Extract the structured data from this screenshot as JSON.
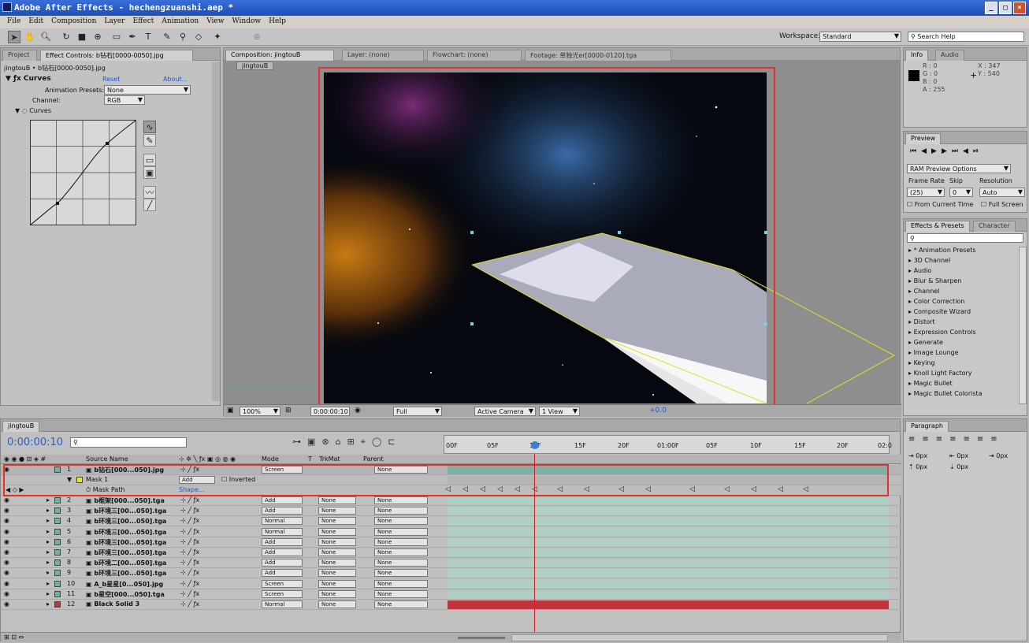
{
  "window": {
    "title": "Adobe After Effects - hechengzuanshi.aep *",
    "buttons": [
      "_",
      "□",
      "×"
    ]
  },
  "menu": [
    "File",
    "Edit",
    "Composition",
    "Layer",
    "Effect",
    "Animation",
    "View",
    "Window",
    "Help"
  ],
  "toolbar": {
    "workspace_label": "Workspace:",
    "workspace_value": "Standard",
    "search_placeholder": "Search Help"
  },
  "project_panel": {
    "tabs": [
      "Project",
      "Effect Controls: b钻石[0000-0050].jpg"
    ],
    "breadcrumb": "jingtouB • b钻石[0000-0050].jpg",
    "effect_name": "Curves",
    "reset": "Reset",
    "about": "About...",
    "presets_label": "Animation Presets:",
    "presets_value": "None",
    "channel_label": "Channel:",
    "channel_value": "RGB",
    "curves_label": "Curves"
  },
  "comp_panel": {
    "tabs": [
      "Composition: jingtouB",
      "Layer: (none)",
      "Flowchart: (none)",
      "Footage: 单独光er[0000-0120].tga"
    ],
    "crumb": "jingtouB",
    "zoom": "100%",
    "time": "0:00:00:10",
    "resolution": "Full",
    "camera": "Active Camera",
    "views": "1 View",
    "exposure": "+0.0"
  },
  "info_panel": {
    "tabs": [
      "Info",
      "Audio"
    ],
    "r": "R : 0",
    "g": "G : 0",
    "b": "B : 0",
    "a": "A : 255",
    "x": "X : 347",
    "y": "Y : 540"
  },
  "preview_panel": {
    "tab": "Preview",
    "ram": "RAM Preview Options",
    "frame_rate_label": "Frame Rate",
    "skip_label": "Skip",
    "resolution_label": "Resolution",
    "frame_rate": "(25)",
    "skip": "0",
    "resolution": "Auto",
    "from_current": "From Current Time",
    "full_screen": "Full Screen"
  },
  "effects_panel": {
    "tabs": [
      "Effects & Presets",
      "Character"
    ],
    "items": [
      "* Animation Presets",
      "3D Channel",
      "Audio",
      "Blur & Sharpen",
      "Channel",
      "Color Correction",
      "Composite Wizard",
      "Distort",
      "Expression Controls",
      "Generate",
      "Image Lounge",
      "Keying",
      "Knoll Light Factory",
      "Magic Bullet",
      "Magic Bullet Colorista"
    ]
  },
  "paragraph_panel": {
    "tab": "Paragraph",
    "values": [
      "0px",
      "0px",
      "0px",
      "0px",
      "0px"
    ]
  },
  "timeline": {
    "tab": "jingtouB",
    "time": "0:00:00:10",
    "ruler": [
      "00F",
      "05F",
      "10F",
      "15F",
      "20F",
      "01:00F",
      "05F",
      "10F",
      "15F",
      "20F",
      "02:0"
    ],
    "headers": {
      "source": "Source Name",
      "mode": "Mode",
      "t": "T",
      "trkmat": "TrkMat",
      "parent": "Parent"
    },
    "mask": {
      "name": "Mask 1",
      "mode": "Add",
      "inverted": "Inverted",
      "path": "Mask Path",
      "shape": "Shape..."
    },
    "layers": [
      {
        "n": "1",
        "name": "b钻石[000...050].jpg",
        "mode": "Screen",
        "trk": "",
        "parent": "None",
        "color": "#6fb29a"
      },
      {
        "n": "2",
        "name": "b框架[000...050].tga",
        "mode": "Add",
        "trk": "None",
        "parent": "None",
        "color": "#6fb29a"
      },
      {
        "n": "3",
        "name": "b环境三[00...050].tga",
        "mode": "Add",
        "trk": "None",
        "parent": "None",
        "color": "#6fb29a"
      },
      {
        "n": "4",
        "name": "b环境三[00...050].tga",
        "mode": "Normal",
        "trk": "None",
        "parent": "None",
        "color": "#6fb29a"
      },
      {
        "n": "5",
        "name": "b环境三[00...050].tga",
        "mode": "Normal",
        "trk": "None",
        "parent": "None",
        "color": "#6fb29a"
      },
      {
        "n": "6",
        "name": "b环境三[00...050].tga",
        "mode": "Add",
        "trk": "None",
        "parent": "None",
        "color": "#6fb29a"
      },
      {
        "n": "7",
        "name": "b环境三[00...050].tga",
        "mode": "Add",
        "trk": "None",
        "parent": "None",
        "color": "#6fb29a"
      },
      {
        "n": "8",
        "name": "b环境二[00...050].tga",
        "mode": "Add",
        "trk": "None",
        "parent": "None",
        "color": "#6fb29a"
      },
      {
        "n": "9",
        "name": "b环境三[00...050].tga",
        "mode": "Add",
        "trk": "None",
        "parent": "None",
        "color": "#6fb29a"
      },
      {
        "n": "10",
        "name": "A_b星星[0...050].jpg",
        "mode": "Screen",
        "trk": "None",
        "parent": "None",
        "color": "#6fb29a"
      },
      {
        "n": "11",
        "name": "b星空[000...050].tga",
        "mode": "Screen",
        "trk": "None",
        "parent": "None",
        "color": "#6fb29a"
      },
      {
        "n": "12",
        "name": "Black Solid 3",
        "mode": "Normal",
        "trk": "None",
        "parent": "None",
        "color": "#c0343c"
      }
    ]
  }
}
